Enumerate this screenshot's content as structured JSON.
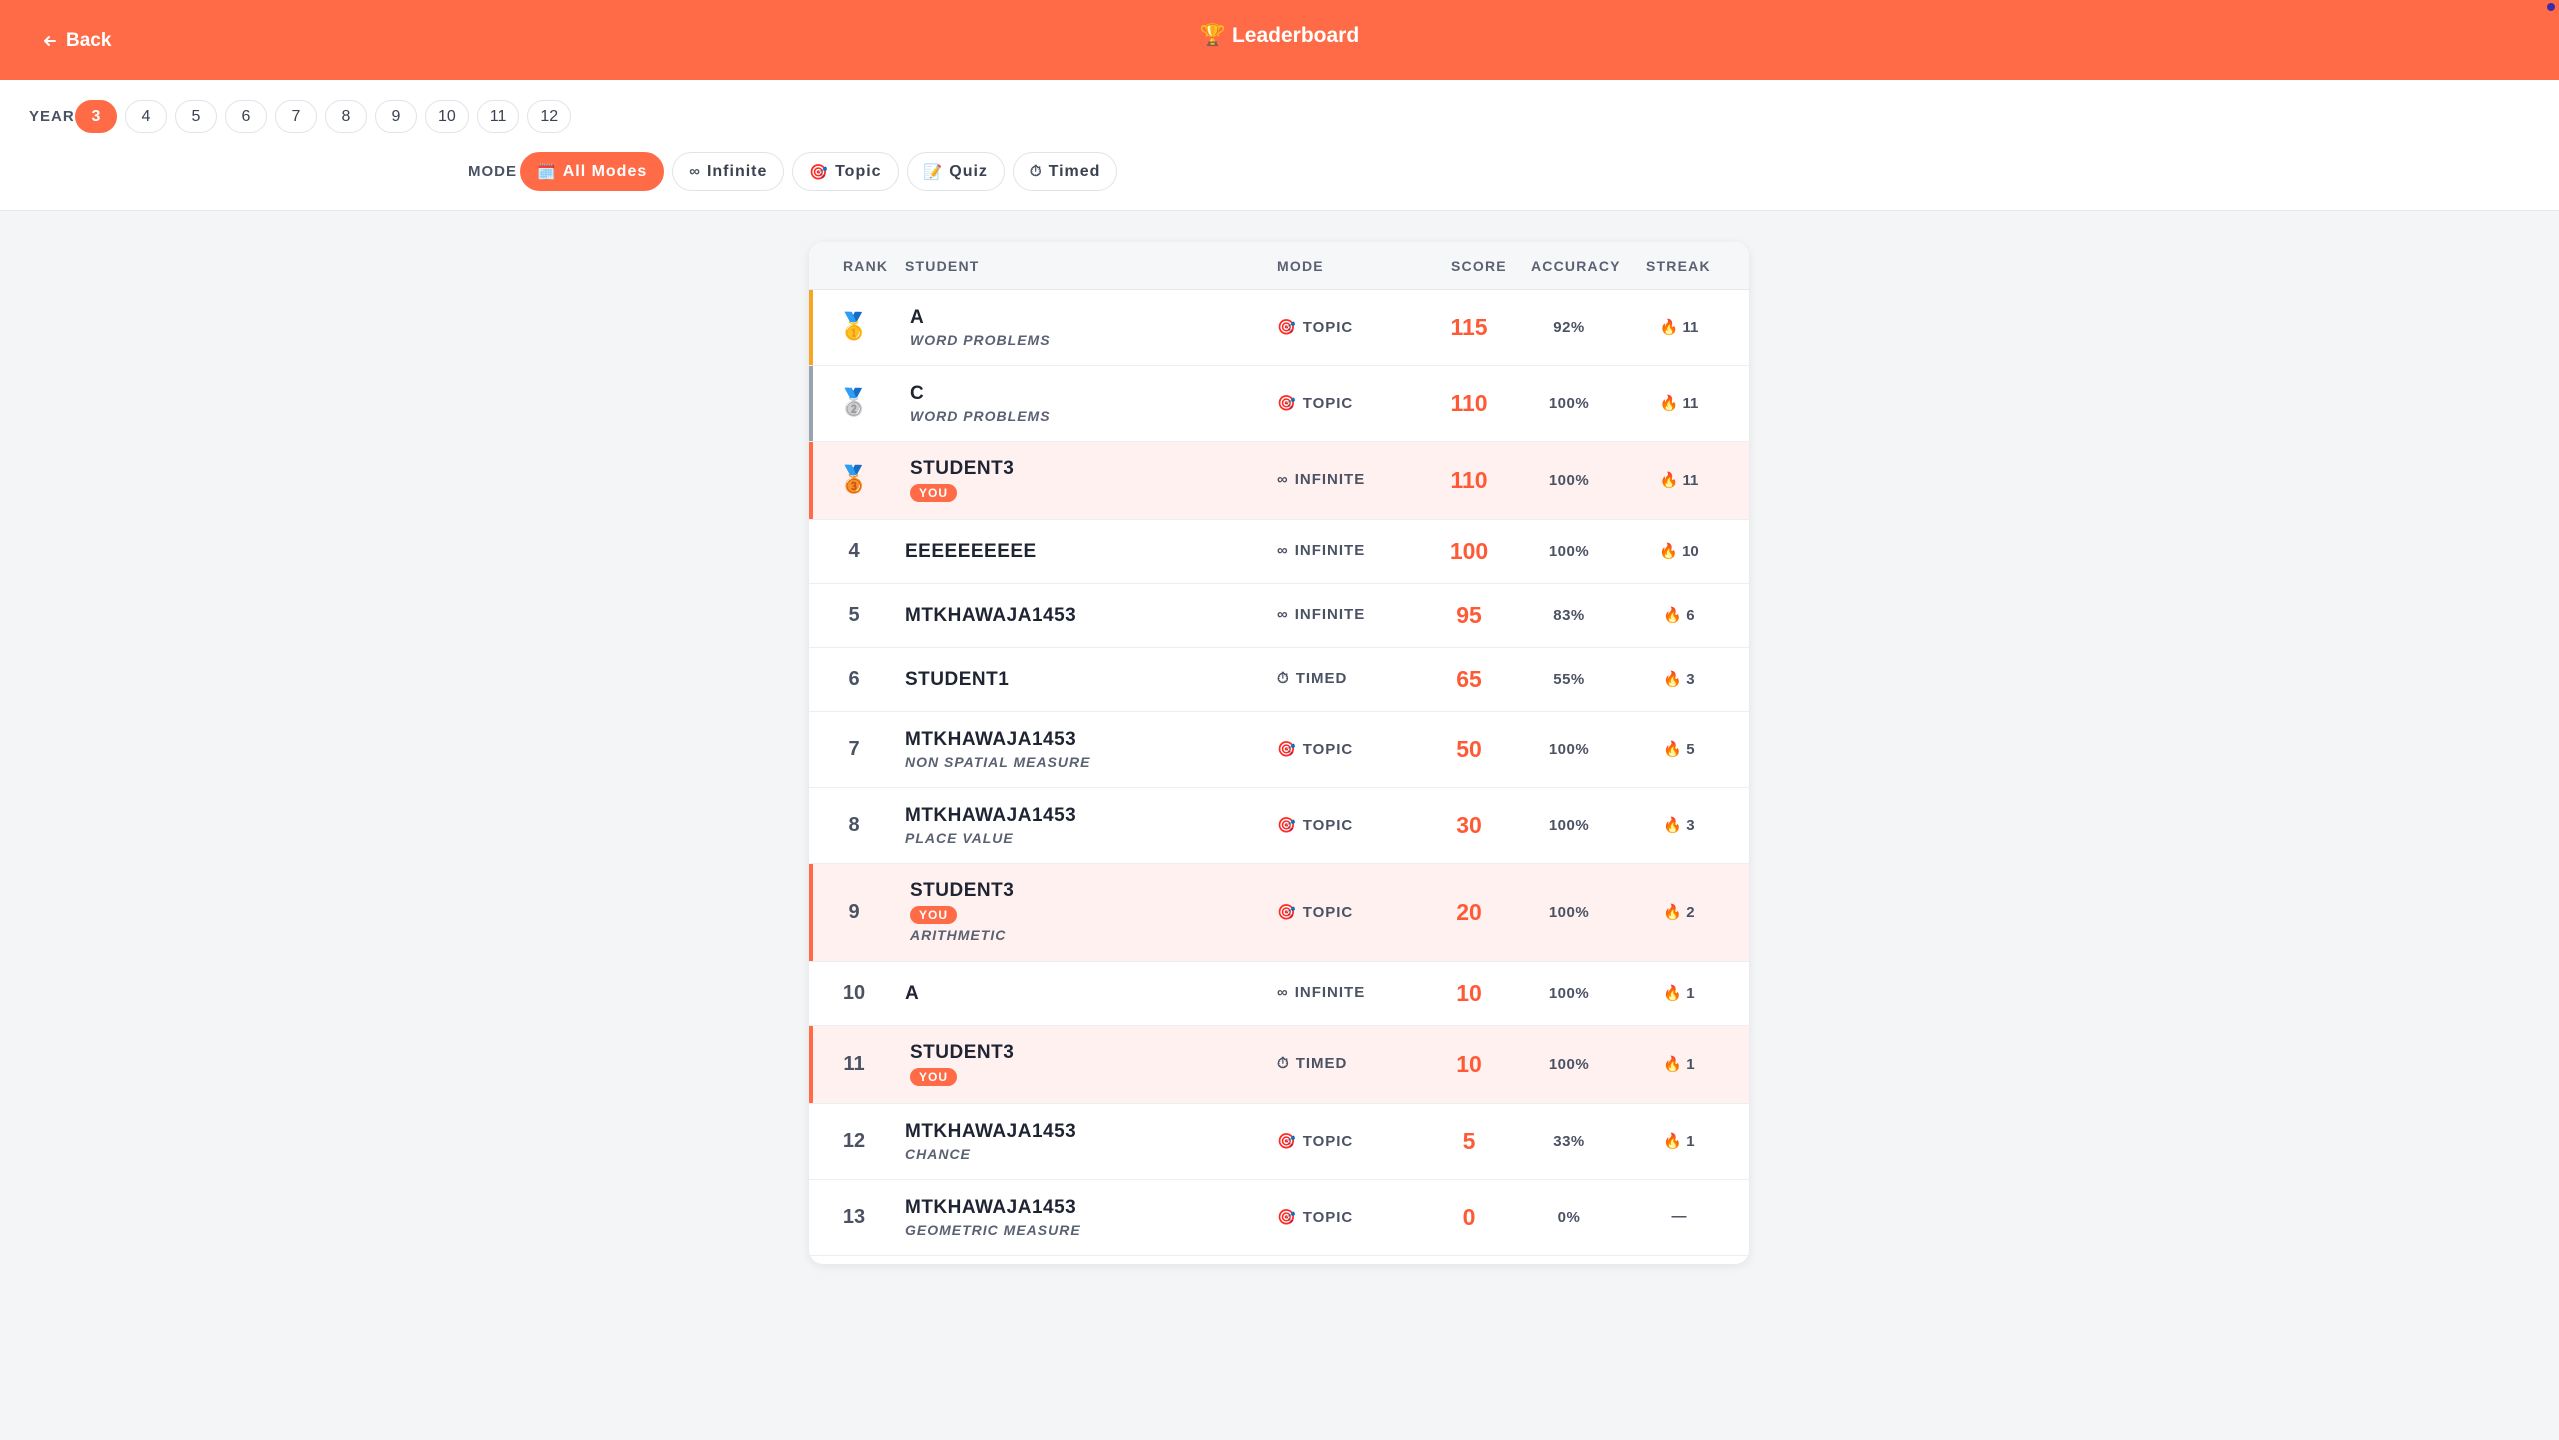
{
  "header": {
    "back_label": "Back",
    "title": "Leaderboard",
    "title_icon": "🏆"
  },
  "filters": {
    "year_label": "YEAR",
    "years": [
      "3",
      "4",
      "5",
      "6",
      "7",
      "8",
      "9",
      "10",
      "11",
      "12"
    ],
    "selected_year": "3",
    "mode_label": "MODE",
    "modes": [
      {
        "label": "All Modes",
        "icon": "🗓️",
        "active": true
      },
      {
        "label": "Infinite",
        "icon": "∞",
        "active": false
      },
      {
        "label": "Topic",
        "icon": "🎯",
        "active": false
      },
      {
        "label": "Quiz",
        "icon": "📝",
        "active": false
      },
      {
        "label": "Timed",
        "icon": "⏱",
        "active": false
      }
    ]
  },
  "table": {
    "columns": {
      "rank": "RANK",
      "student": "STUDENT",
      "mode": "MODE",
      "score": "SCORE",
      "accuracy": "ACCURACY",
      "streak": "STREAK"
    },
    "you_label": "YOU",
    "rows": [
      {
        "rank": "1",
        "medal": "🥇",
        "name": "A",
        "sub": "WORD PROBLEMS",
        "you": false,
        "mode": "TOPIC",
        "mode_icon": "🎯",
        "score": "115",
        "accuracy": "92%",
        "streak": "11",
        "accent": "#f5a623"
      },
      {
        "rank": "2",
        "medal": "🥈",
        "name": "C",
        "sub": "WORD PROBLEMS",
        "you": false,
        "mode": "TOPIC",
        "mode_icon": "🎯",
        "score": "110",
        "accuracy": "100%",
        "streak": "11",
        "accent": "#9aa3b2"
      },
      {
        "rank": "3",
        "medal": "🥉",
        "name": "STUDENT3",
        "sub": "",
        "you": true,
        "mode": "INFINITE",
        "mode_icon": "∞",
        "score": "110",
        "accuracy": "100%",
        "streak": "11",
        "accent": "#ff6b47"
      },
      {
        "rank": "4",
        "medal": "",
        "name": "EEEEEEEEEE",
        "sub": "",
        "you": false,
        "mode": "INFINITE",
        "mode_icon": "∞",
        "score": "100",
        "accuracy": "100%",
        "streak": "10",
        "accent": ""
      },
      {
        "rank": "5",
        "medal": "",
        "name": "MTKHAWAJA1453",
        "sub": "",
        "you": false,
        "mode": "INFINITE",
        "mode_icon": "∞",
        "score": "95",
        "accuracy": "83%",
        "streak": "6",
        "accent": ""
      },
      {
        "rank": "6",
        "medal": "",
        "name": "STUDENT1",
        "sub": "",
        "you": false,
        "mode": "TIMED",
        "mode_icon": "⏱",
        "score": "65",
        "accuracy": "55%",
        "streak": "3",
        "accent": ""
      },
      {
        "rank": "7",
        "medal": "",
        "name": "MTKHAWAJA1453",
        "sub": "NON SPATIAL MEASURE",
        "you": false,
        "mode": "TOPIC",
        "mode_icon": "🎯",
        "score": "50",
        "accuracy": "100%",
        "streak": "5",
        "accent": ""
      },
      {
        "rank": "8",
        "medal": "",
        "name": "MTKHAWAJA1453",
        "sub": "PLACE VALUE",
        "you": false,
        "mode": "TOPIC",
        "mode_icon": "🎯",
        "score": "30",
        "accuracy": "100%",
        "streak": "3",
        "accent": ""
      },
      {
        "rank": "9",
        "medal": "",
        "name": "STUDENT3",
        "sub": "ARITHMETIC",
        "you": true,
        "mode": "TOPIC",
        "mode_icon": "🎯",
        "score": "20",
        "accuracy": "100%",
        "streak": "2",
        "accent": "#ff6b47"
      },
      {
        "rank": "10",
        "medal": "",
        "name": "A",
        "sub": "",
        "you": false,
        "mode": "INFINITE",
        "mode_icon": "∞",
        "score": "10",
        "accuracy": "100%",
        "streak": "1",
        "accent": ""
      },
      {
        "rank": "11",
        "medal": "",
        "name": "STUDENT3",
        "sub": "",
        "you": true,
        "mode": "TIMED",
        "mode_icon": "⏱",
        "score": "10",
        "accuracy": "100%",
        "streak": "1",
        "accent": "#ff6b47"
      },
      {
        "rank": "12",
        "medal": "",
        "name": "MTKHAWAJA1453",
        "sub": "CHANCE",
        "you": false,
        "mode": "TOPIC",
        "mode_icon": "🎯",
        "score": "5",
        "accuracy": "33%",
        "streak": "1",
        "accent": ""
      },
      {
        "rank": "13",
        "medal": "",
        "name": "MTKHAWAJA1453",
        "sub": "GEOMETRIC MEASURE",
        "you": false,
        "mode": "TOPIC",
        "mode_icon": "🎯",
        "score": "0",
        "accuracy": "0%",
        "streak": "—",
        "accent": ""
      }
    ]
  },
  "colors": {
    "brand": "#ff6b47",
    "score": "#ff5a36",
    "you_row_bg": "#fff1ef",
    "gold": "#f5a623",
    "silver": "#9aa3b2"
  },
  "streak_icon": "🔥"
}
